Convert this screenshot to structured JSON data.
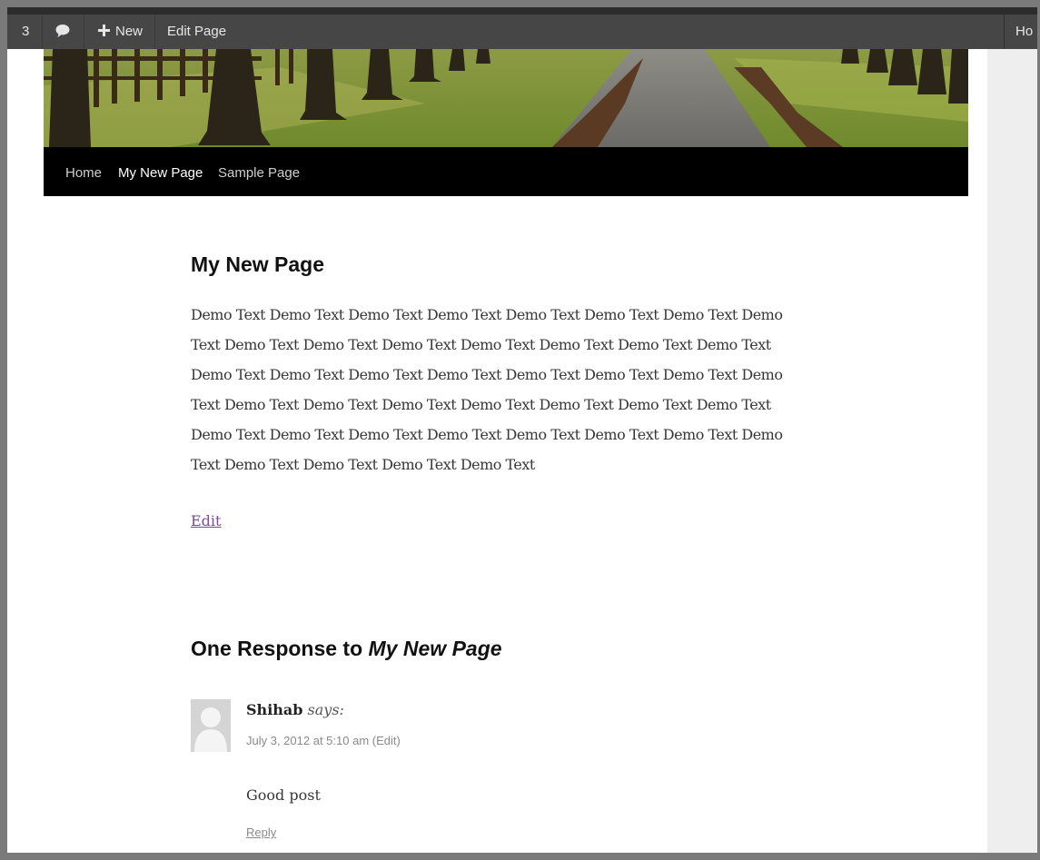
{
  "admin_bar": {
    "count_fragment": "3",
    "new_label": "New",
    "edit_page_label": "Edit Page",
    "right_fragment": "Ho",
    "comment_icon": "speech-bubble-icon",
    "plus_icon": "plus-icon"
  },
  "nav": {
    "items": [
      {
        "label": "Home",
        "active": false
      },
      {
        "label": "My New Page",
        "active": true
      },
      {
        "label": "Sample Page",
        "active": false
      }
    ]
  },
  "page": {
    "title": "My New Page",
    "body": "Demo Text Demo Text Demo Text Demo Text Demo Text Demo Text Demo Text Demo Text Demo Text Demo Text Demo Text Demo Text Demo Text Demo Text Demo Text Demo Text Demo Text Demo Text Demo Text Demo Text Demo Text Demo Text Demo Text Demo Text Demo Text Demo Text Demo Text Demo Text Demo Text Demo Text Demo Text Demo Text Demo Text Demo Text Demo Text Demo Text Demo Text Demo Text Demo Text Demo Text Demo Text Demo Text",
    "edit_label": "Edit"
  },
  "responses": {
    "title_prefix": "One Response to ",
    "title_page": "My New Page",
    "comments": [
      {
        "author": "Shihab",
        "says": "says:",
        "meta": "July 3, 2012 at 5:10 am (Edit)",
        "text": "Good post",
        "reply_label": "Reply"
      }
    ]
  },
  "colors": {
    "admin_bar": "#464646",
    "nav_bg": "#000000",
    "link_visited": "#7c4a97"
  }
}
